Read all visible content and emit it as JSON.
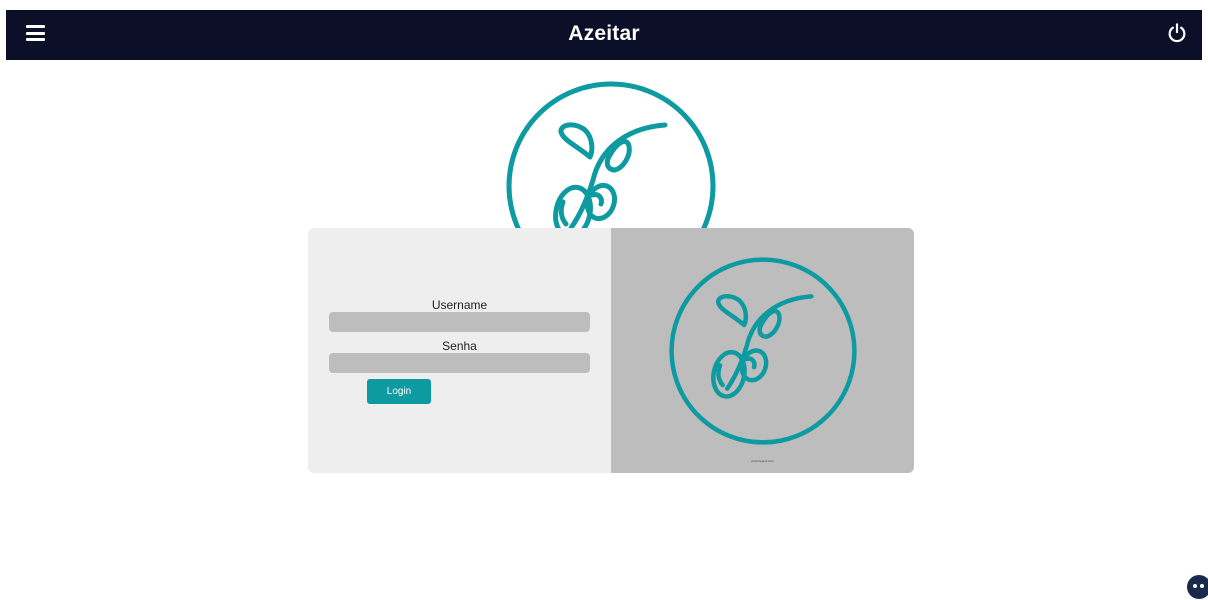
{
  "header": {
    "title": "Azeitar",
    "menu_icon": "hamburger-menu-icon",
    "power_icon": "power-icon"
  },
  "login": {
    "username_label": "Username",
    "username_value": "",
    "password_label": "Senha",
    "password_value": "",
    "login_label": "Login"
  },
  "branding": {
    "logo_icon": "olive-branch-icon",
    "credit": "www.freepik.com"
  },
  "chat": {
    "icon": "chat-bubble-icon"
  },
  "colors": {
    "header_bg": "#0b0f28",
    "accent": "#0d9aa0",
    "card_left_bg": "#eeeeee",
    "card_right_bg": "#bdbdbd",
    "input_bg": "#bdbdbd"
  }
}
